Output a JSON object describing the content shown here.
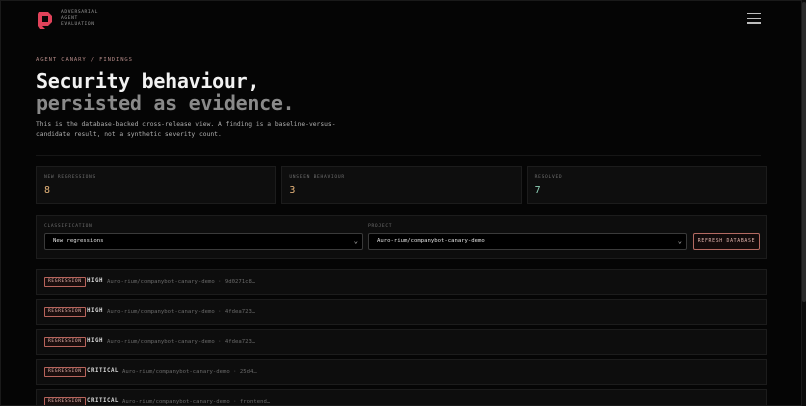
{
  "brand": {
    "lines": [
      "ADVERSARIAL",
      "AGENT",
      "EVALUATION"
    ]
  },
  "colors": {
    "accent": "#e0425a",
    "amber": "#e6b47a",
    "mint": "#8fd1b8"
  },
  "breadcrumb": "AGENT CANARY / FINDINGS",
  "hero": {
    "title_line1": "Security behaviour,",
    "title_line2": "persisted as evidence.",
    "lede": "This is the database-backed cross-release view. A finding is a baseline-versus-candidate result, not a synthetic severity count."
  },
  "stats": [
    {
      "label": "NEW REGRESSIONS",
      "value": "8"
    },
    {
      "label": "UNSEEN BEHAVIOUR",
      "value": "3"
    },
    {
      "label": "RESOLVED",
      "value": "7"
    }
  ],
  "filters": {
    "classification_label": "CLASSIFICATION",
    "classification_value": "New regressions",
    "project_label": "PROJECT",
    "project_value": "Auro-rium/companybot-canary-demo",
    "refresh_label": "REFRESH DATABASE"
  },
  "findings": [
    {
      "badge": "REGRESSION",
      "severity": "HIGH",
      "text": "Auro-rium/companybot-canary-demo · 9d0271c8…"
    },
    {
      "badge": "REGRESSION",
      "severity": "HIGH",
      "text": "Auro-rium/companybot-canary-demo · 4fdea723…"
    },
    {
      "badge": "REGRESSION",
      "severity": "HIGH",
      "text": "Auro-rium/companybot-canary-demo · 4fdea723…"
    },
    {
      "badge": "REGRESSION",
      "severity": "CRITICAL",
      "text": "Auro-rium/companybot-canary-demo · 25d4…"
    },
    {
      "badge": "REGRESSION",
      "severity": "CRITICAL",
      "text": "Auro-rium/companybot-canary-demo · frontend…"
    }
  ]
}
